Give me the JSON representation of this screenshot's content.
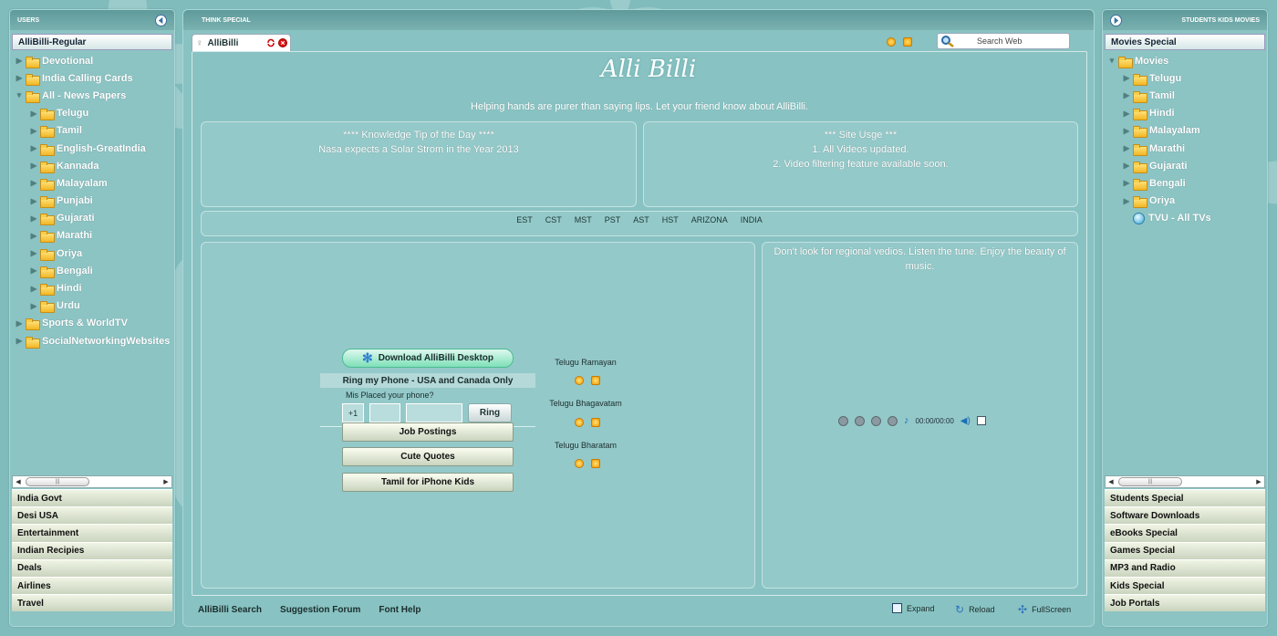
{
  "left_panel": {
    "title": "USERS",
    "selected": "AlliBilli-Regular",
    "tree": [
      {
        "label": "Devotional",
        "level": 0,
        "expanded": false
      },
      {
        "label": "India Calling Cards",
        "level": 0,
        "expanded": false
      },
      {
        "label": "All - News Papers",
        "level": 0,
        "expanded": true
      },
      {
        "label": "Telugu",
        "level": 1
      },
      {
        "label": "Tamil",
        "level": 1
      },
      {
        "label": "English-GreatIndia",
        "level": 1
      },
      {
        "label": "Kannada",
        "level": 1
      },
      {
        "label": "Malayalam",
        "level": 1
      },
      {
        "label": "Punjabi",
        "level": 1
      },
      {
        "label": "Gujarati",
        "level": 1
      },
      {
        "label": "Marathi",
        "level": 1
      },
      {
        "label": "Oriya",
        "level": 1
      },
      {
        "label": "Bengali",
        "level": 1
      },
      {
        "label": "Hindi",
        "level": 1
      },
      {
        "label": "Urdu",
        "level": 1
      },
      {
        "label": "Sports & WorldTV",
        "level": 0,
        "expanded": false
      },
      {
        "label": "SocialNetworkingWebsites",
        "level": 0,
        "expanded": false
      }
    ],
    "categories": [
      "India Govt",
      "Desi USA",
      "Entertainment",
      "Indian Recipies",
      "Deals",
      "Airlines",
      "Travel"
    ]
  },
  "right_panel": {
    "title": "STUDENTS KIDS MOVIES",
    "selected": "Movies Special",
    "tree": [
      {
        "label": "Movies",
        "level": 0,
        "expanded": true
      },
      {
        "label": "Telugu",
        "level": 1
      },
      {
        "label": "Tamil",
        "level": 1
      },
      {
        "label": "Hindi",
        "level": 1
      },
      {
        "label": "Malayalam",
        "level": 1
      },
      {
        "label": "Marathi",
        "level": 1
      },
      {
        "label": "Gujarati",
        "level": 1
      },
      {
        "label": "Bengali",
        "level": 1
      },
      {
        "label": "Oriya",
        "level": 1
      },
      {
        "label": "TVU - All TVs",
        "level": 1,
        "icon": "globe-icon"
      }
    ],
    "categories": [
      "Students Special",
      "Software Downloads",
      "eBooks Special",
      "Games Special",
      "MP3 and Radio",
      "Kids Special",
      "Job Portals"
    ]
  },
  "center": {
    "header": "THINK SPECIAL",
    "tab_label": "AlliBilli",
    "search_placeholder": "Search Web",
    "logo_text": "Alli Billi",
    "tagline": "Helping hands are purer than saying lips. Let your friend know about AlliBilli.",
    "tip_title": "****  Knowledge Tip of the Day  ****",
    "tip_text": "Nasa expects a Solar Strom in the Year 2013",
    "site_title": "*** Site Usge ***",
    "site_line1": "1. All Videos updated.",
    "site_line2": "2. Video filtering feature available soon.",
    "timezones": [
      "EST",
      "CST",
      "MST",
      "PST",
      "AST",
      "HST",
      "ARIZONA",
      "INDIA"
    ],
    "download_btn": "Download AlliBilli Desktop",
    "ring_title": "Ring my Phone - USA and Canada Only",
    "misplaced": "Mis Placed your phone?",
    "country_code": "+1",
    "ring_btn": "Ring",
    "buttons": [
      "Job Postings",
      "Cute Quotes",
      "Tamil for iPhone Kids"
    ],
    "songs": [
      "Telugu Ramayan",
      "Telugu Bhagavatam",
      "Telugu Bharatam"
    ],
    "music_text": "Don't look for regional vedios. Listen the tune. Enjoy the beauty of music.",
    "player_time": "00:00/00:00",
    "footer_links": [
      "AlliBilli Search",
      "Suggestion Forum",
      "Font Help"
    ],
    "footer_right": [
      "Expand",
      "Reload",
      "FullScreen"
    ]
  },
  "colors": {
    "background": "#80bcbc",
    "panel": "#8cc4c4",
    "header": "#5f9a9a",
    "accent_green": "#7ee0b8",
    "folder": "#f2b724"
  }
}
